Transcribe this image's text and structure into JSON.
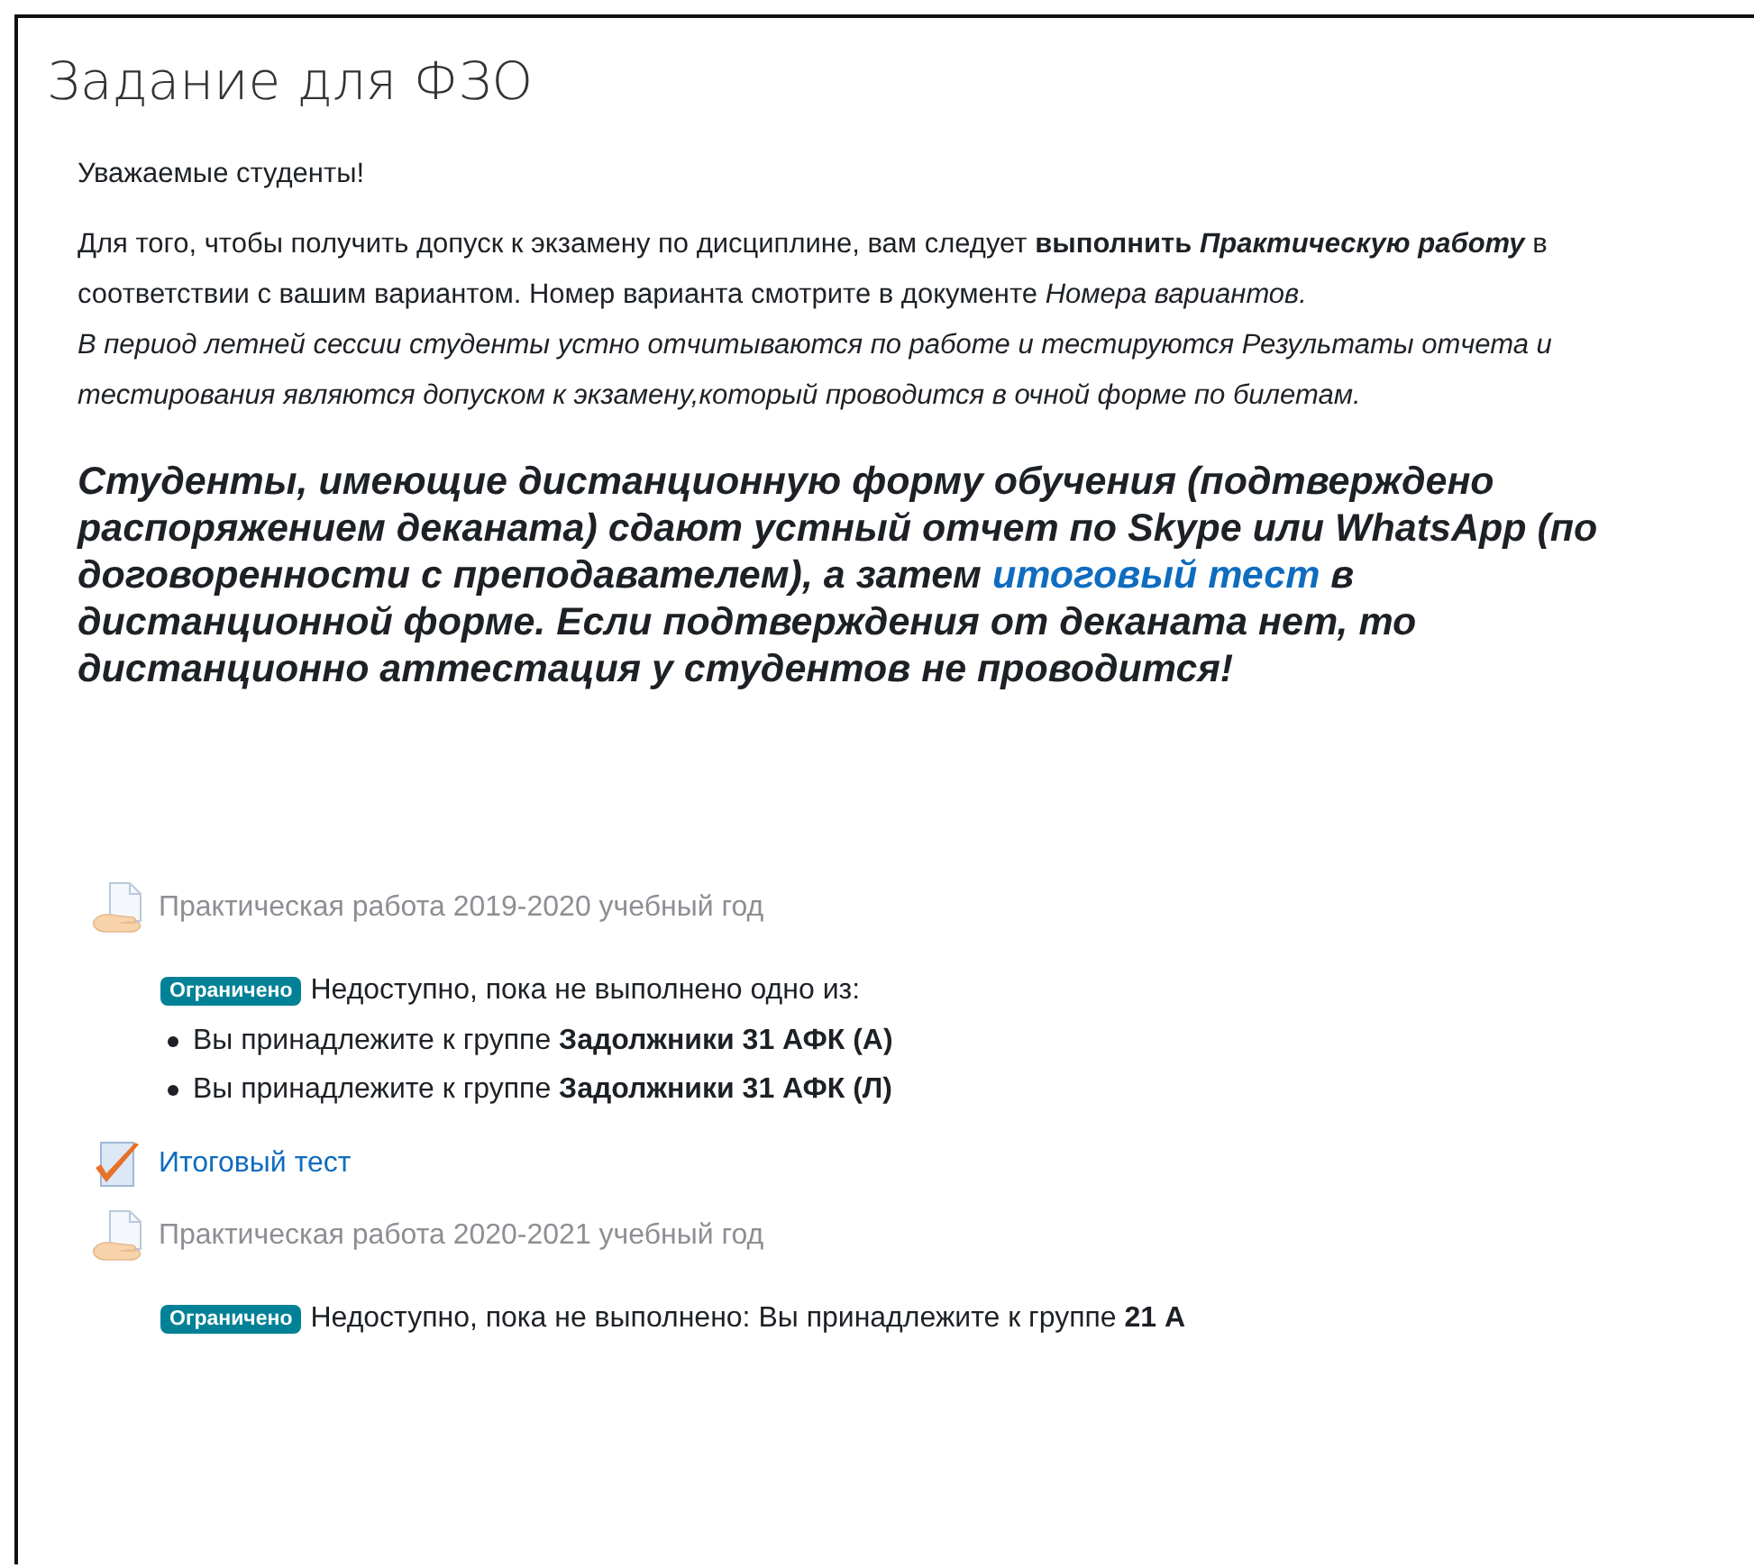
{
  "title": "Задание для ФЗО",
  "greeting": "Уважаемые студенты!",
  "paragraph": {
    "lead": "Для того, чтобы получить допуск к экзамену по дисциплине, вам следует ",
    "strong": "выполнить",
    "strong_emphasis": "Практическую работу",
    "middle": " в соответствии с вашим вариантом. Номер варианта смотрите в документе  ",
    "emphasis": "Номера вариантов."
  },
  "note": "В период летней сессии студенты устно отчитываются по работе и тестируются Результаты отчета и тестирования являются допуском к экзамену,который проводится в очной форме по билетам.",
  "announcement": {
    "before": "Студенты, имеющие дистанционную форму обучения (подтверждено распоряжением деканата)  сдают устный отчет по Skype или WhatsApp (по договоренности с преподавателем), а затем ",
    "link": "итоговый тест",
    "after": " в дистанционной форме. Если подтверждения от деканата нет, то дистанционно аттестация у студентов не проводится!"
  },
  "activities": [
    {
      "kind": "resource",
      "label": "Практическая работа 2019-2020 учебный год",
      "dimmed": true,
      "restriction": {
        "badge": "Ограничено",
        "text": "Недоступно, пока не выполнено одно из:",
        "conditions": [
          "Вы принадлежите к группе **Задолжники 31 АФК (А)**",
          "Вы принадлежите к группе **Задолжники 31 АФК (Л)**"
        ]
      }
    },
    {
      "kind": "quiz",
      "label": "Итоговый тест",
      "dimmed": false
    },
    {
      "kind": "resource",
      "label": "Практическая работа 2020-2021 учебный год",
      "dimmed": true,
      "restriction": {
        "badge": "Ограничено",
        "text": "Недоступно, пока не выполнено: Вы принадлежите к группе **21 А**"
      }
    }
  ]
}
